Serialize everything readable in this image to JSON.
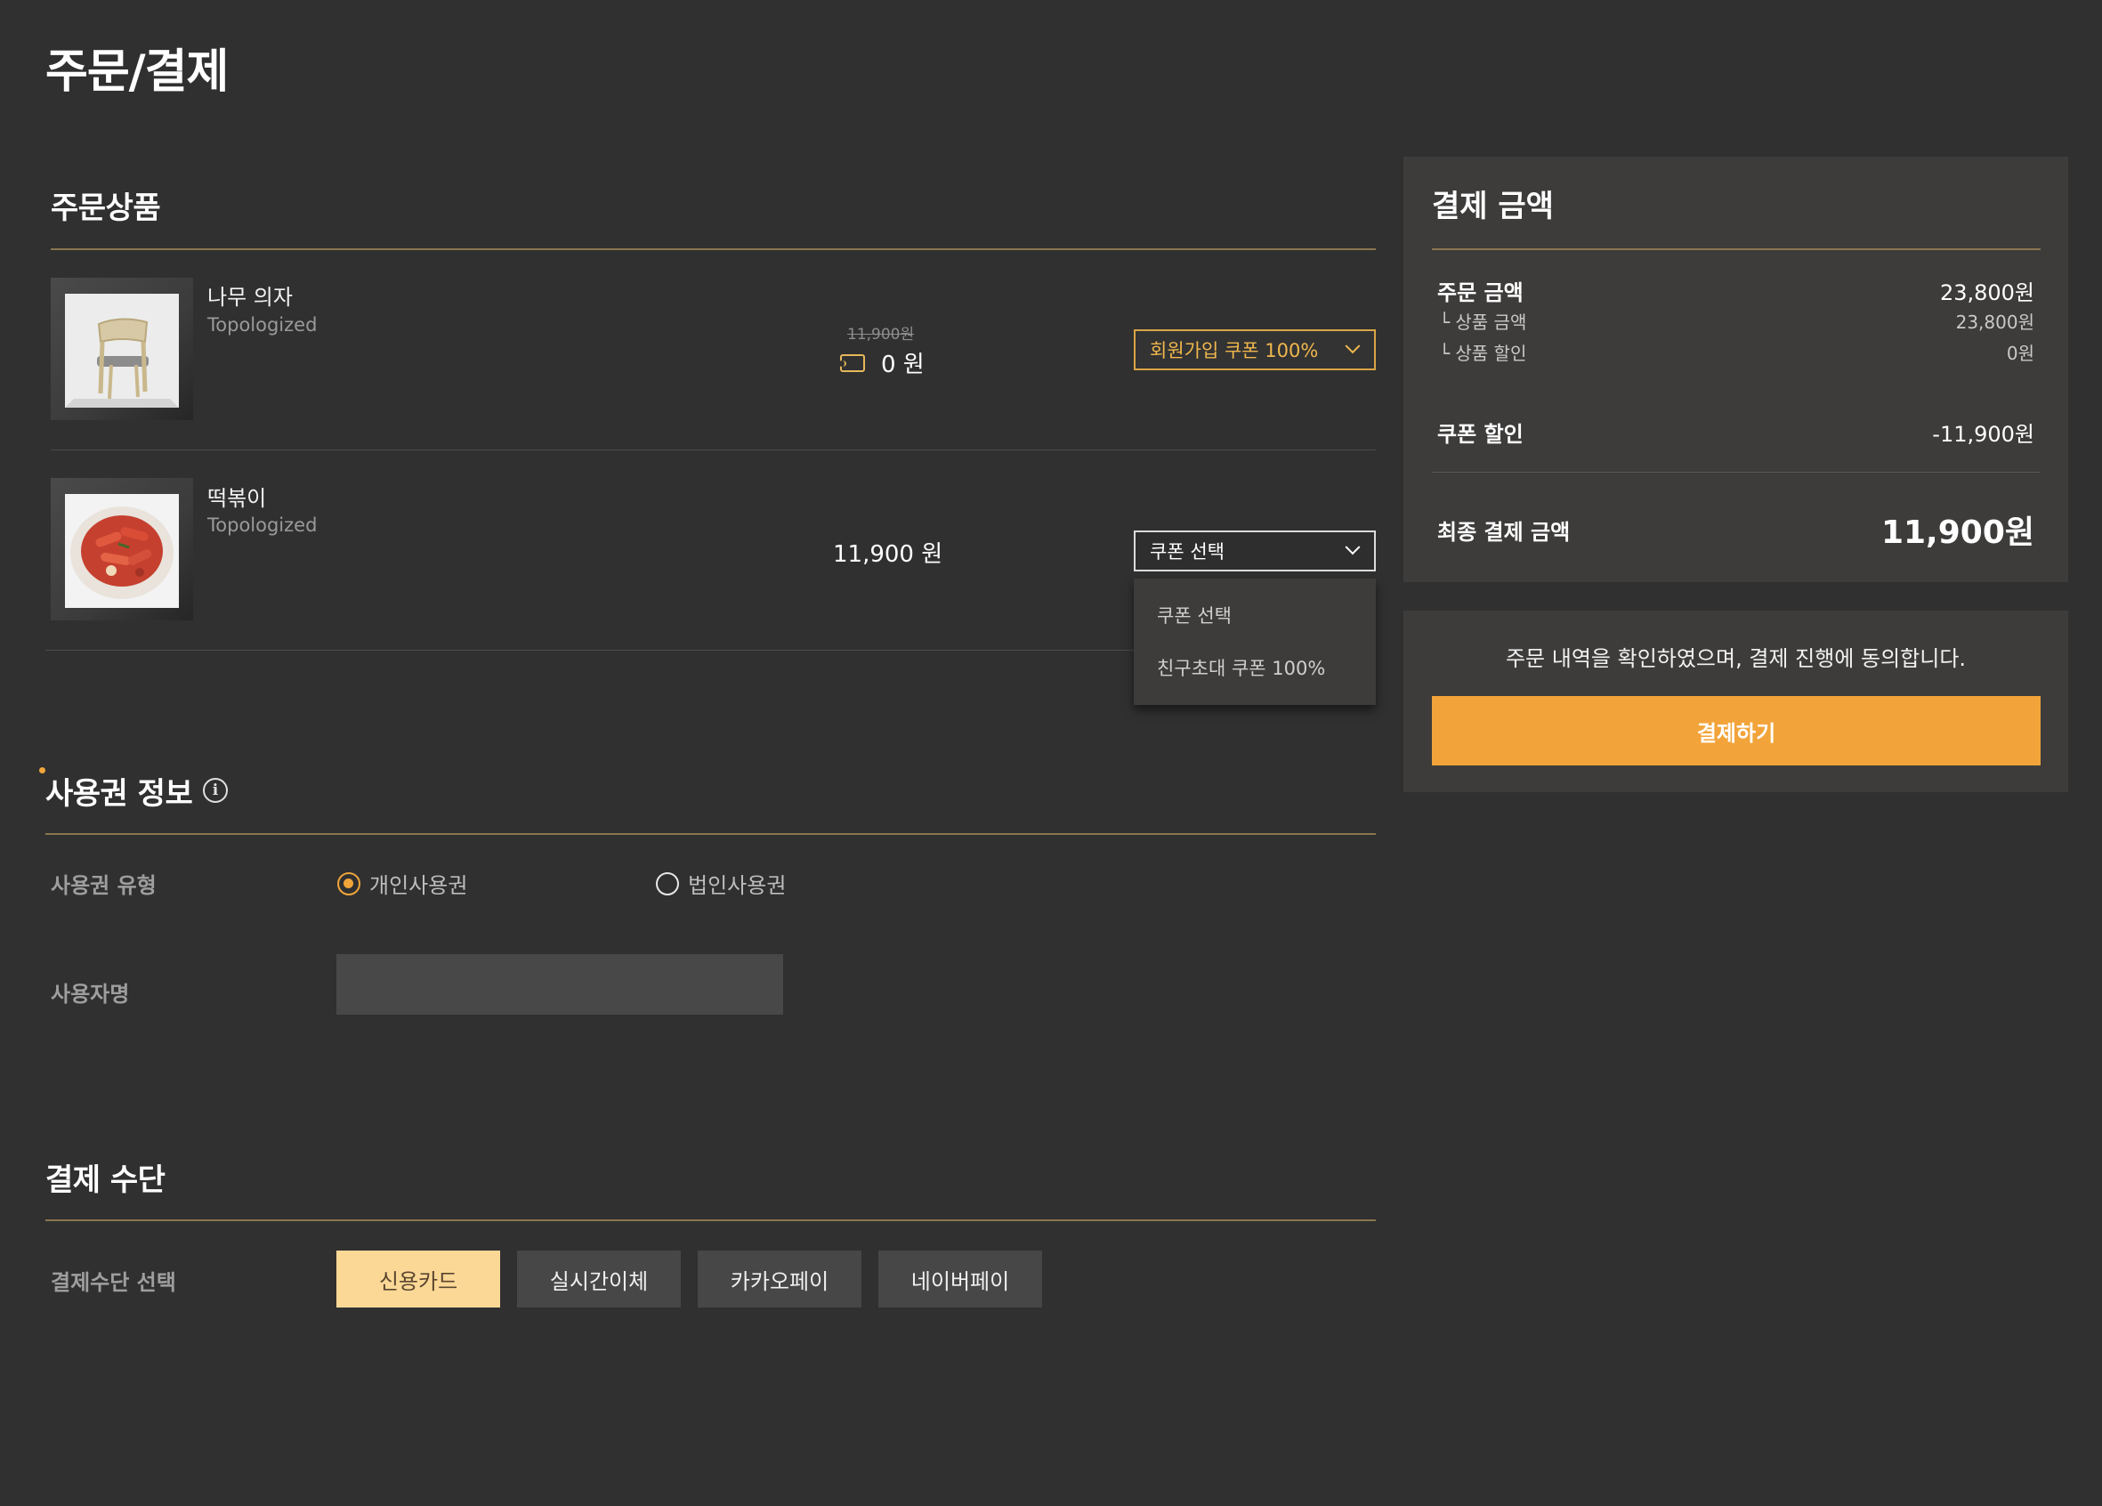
{
  "page_title": "주문/결제",
  "order_items": {
    "title": "주문상품",
    "items": [
      {
        "name": "나무 의자",
        "brand": "Topologized",
        "original_price": "11,900원",
        "final_price": "0 원",
        "coupon_select": "회원가입 쿠폰 100%"
      },
      {
        "name": "떡볶이",
        "brand": "Topologized",
        "price": "11,900 원",
        "coupon_select": "쿠폰 선택"
      }
    ],
    "coupon_dropdown": [
      "쿠폰 선택",
      "친구초대 쿠폰 100%"
    ]
  },
  "license": {
    "title": "사용권 정보",
    "type_label": "사용권 유형",
    "options": [
      {
        "label": "개인사용권",
        "selected": true
      },
      {
        "label": "법인사용권",
        "selected": false
      }
    ],
    "user_name_label": "사용자명",
    "user_name_value": ""
  },
  "payment_method": {
    "title": "결제 수단",
    "select_label": "결제수단 선택",
    "methods": [
      {
        "label": "신용카드",
        "selected": true
      },
      {
        "label": "실시간이체",
        "selected": false
      },
      {
        "label": "카카오페이",
        "selected": false
      },
      {
        "label": "네이버페이",
        "selected": false
      }
    ]
  },
  "summary": {
    "title": "결제 금액",
    "order_amount_label": "주문 금액",
    "order_amount": "23,800원",
    "product_amount_label": "└ 상품 금액",
    "product_amount": "23,800원",
    "product_discount_label": "└ 상품 할인",
    "product_discount": "0원",
    "coupon_discount_label": "쿠폰 할인",
    "coupon_discount": "-11,900원",
    "final_label": "최종 결제 금액",
    "final_amount": "11,900원"
  },
  "agreement": {
    "text": "주문 내역을 확인하였으며, 결제 진행에 동의합니다.",
    "button": "결제하기"
  },
  "colors": {
    "background": "#303030",
    "panel": "#3d3c3b",
    "accent": "#f2a43a",
    "selected_method": "#fbd896",
    "gold_rule": "#8a7650"
  }
}
